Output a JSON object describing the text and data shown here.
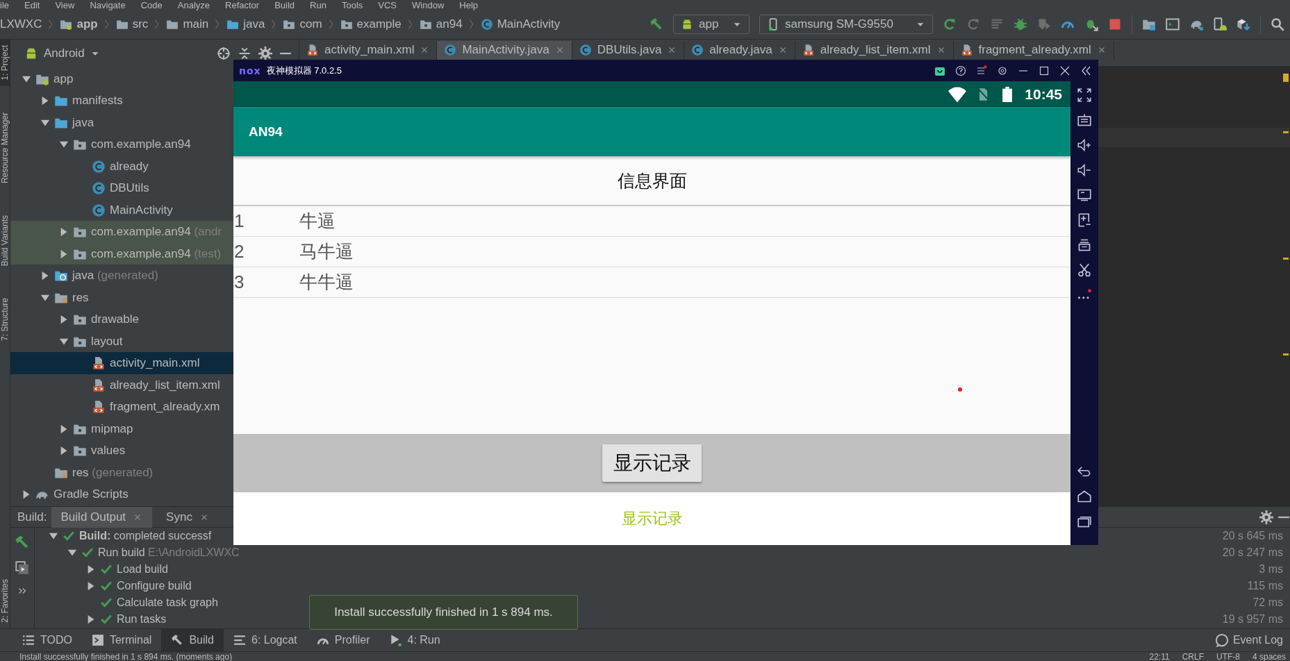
{
  "menu_bar": [
    "ile",
    "Edit",
    "View",
    "Navigate",
    "Code",
    "Analyze",
    "Refactor",
    "Build",
    "Run",
    "Tools",
    "VCS",
    "Window",
    "Help"
  ],
  "breadcrumbs": [
    {
      "label": "LXWXC",
      "kind": "project"
    },
    {
      "label": "app",
      "kind": "module"
    },
    {
      "label": "src",
      "kind": "folder"
    },
    {
      "label": "main",
      "kind": "folder"
    },
    {
      "label": "java",
      "kind": "source"
    },
    {
      "label": "com",
      "kind": "package"
    },
    {
      "label": "example",
      "kind": "package"
    },
    {
      "label": "an94",
      "kind": "package"
    },
    {
      "label": "MainActivity",
      "kind": "class"
    }
  ],
  "run_config": {
    "label": "app"
  },
  "device": {
    "label": "samsung SM-G9550"
  },
  "left_stripe": {
    "top": [
      {
        "label": "1: Project",
        "selected": true
      },
      {
        "label": "Resource Manager",
        "selected": false
      },
      {
        "label": "Build Variants",
        "selected": false
      },
      {
        "label": "7: Structure",
        "selected": false
      }
    ],
    "bottom": [
      {
        "label": "2: Favorites",
        "selected": false
      }
    ]
  },
  "project_panel": {
    "view": "Android",
    "tree": [
      {
        "label": "app",
        "kind": "module",
        "expanded": true,
        "selected": false,
        "children": [
          {
            "label": "manifests",
            "kind": "folder",
            "expanded": false,
            "selected": false
          },
          {
            "label": "java",
            "kind": "folder",
            "expanded": true,
            "selected": false,
            "children": [
              {
                "label": "com.example.an94",
                "kind": "package",
                "expanded": true,
                "selected": false,
                "children": [
                  {
                    "label": "already",
                    "kind": "class",
                    "selected": false
                  },
                  {
                    "label": "DBUtils",
                    "kind": "class",
                    "selected": false
                  },
                  {
                    "label": "MainActivity",
                    "kind": "class",
                    "selected": false
                  }
                ]
              },
              {
                "label": "com.example.an94",
                "suffix": "(andr",
                "kind": "package",
                "expanded": false,
                "selected": false,
                "highlighted": true
              },
              {
                "label": "com.example.an94",
                "suffix": "(test)",
                "kind": "package",
                "expanded": false,
                "selected": false,
                "highlighted": true
              }
            ]
          },
          {
            "label": "java",
            "suffix": "(generated)",
            "kind": "generated",
            "expanded": false,
            "selected": false
          },
          {
            "label": "res",
            "kind": "res",
            "expanded": true,
            "selected": false,
            "children": [
              {
                "label": "drawable",
                "kind": "package",
                "expanded": false,
                "selected": false
              },
              {
                "label": "layout",
                "kind": "package",
                "expanded": true,
                "selected": false,
                "children": [
                  {
                    "label": "activity_main.xml",
                    "kind": "xml",
                    "selected": true
                  },
                  {
                    "label": "already_list_item.xml",
                    "kind": "xml",
                    "selected": false
                  },
                  {
                    "label": "fragment_already.xm",
                    "kind": "xml",
                    "selected": false
                  }
                ]
              },
              {
                "label": "mipmap",
                "kind": "package",
                "expanded": false,
                "selected": false
              },
              {
                "label": "values",
                "kind": "package",
                "expanded": false,
                "selected": false
              }
            ]
          },
          {
            "label": "res",
            "suffix": "(generated)",
            "kind": "res",
            "selected": false
          }
        ]
      },
      {
        "label": "Gradle Scripts",
        "kind": "gradle",
        "expanded": false,
        "selected": false
      }
    ]
  },
  "editor_tabs": [
    {
      "label": "activity_main.xml",
      "kind": "xml",
      "selected": false
    },
    {
      "label": "MainActivity.java",
      "kind": "class",
      "selected": true
    },
    {
      "label": "DBUtils.java",
      "kind": "class",
      "selected": false
    },
    {
      "label": "already.java",
      "kind": "class",
      "selected": false
    },
    {
      "label": "already_list_item.xml",
      "kind": "xml",
      "selected": false
    },
    {
      "label": "fragment_already.xml",
      "kind": "xml",
      "selected": false
    }
  ],
  "emulator": {
    "logo": "nox",
    "title": "夜神模拟器 7.0.2.5",
    "time": "10:45",
    "app_title": "AN94",
    "header": "信息界面",
    "rows": [
      {
        "number": "1",
        "name": "牛逼"
      },
      {
        "number": "2",
        "name": "马牛逼"
      },
      {
        "number": "3",
        "name": "牛牛逼"
      }
    ],
    "button": "显示记录",
    "result_text": "显示记录"
  },
  "build_panel": {
    "label": "Build:",
    "tabs": [
      {
        "label": "Build Output",
        "selected": true
      },
      {
        "label": "Sync",
        "selected": false
      }
    ],
    "rows": [
      {
        "text": "**Build:** completed successf",
        "time": "20 s 645 ms",
        "expanded": true,
        "children": [
          {
            "text": "Run build",
            "detail": "E:\\AndroidLXWXC",
            "time": "20 s 247 ms",
            "expanded": true,
            "children": [
              {
                "text": "Load build",
                "time": "3 ms",
                "expanded": false
              },
              {
                "text": "Configure build",
                "time": "115 ms",
                "expanded": false
              },
              {
                "text": "Calculate task graph",
                "time": "72 ms"
              },
              {
                "text": "Run tasks",
                "time": "19 s 957 ms",
                "expanded": false
              }
            ]
          }
        ]
      }
    ]
  },
  "notification": {
    "text": "Install successfully finished in 1 s 894 ms."
  },
  "tool_windows": [
    {
      "label": "TODO",
      "kind": "todo",
      "selected": false
    },
    {
      "label": "Terminal",
      "kind": "terminal",
      "selected": false
    },
    {
      "label": "Build",
      "kind": "build",
      "selected": true
    },
    {
      "label": "6: Logcat",
      "kind": "logcat",
      "selected": false
    },
    {
      "label": "Profiler",
      "kind": "profiler",
      "selected": false
    },
    {
      "label": "4: Run",
      "kind": "run",
      "selected": false
    }
  ],
  "event_log": {
    "label": "Event Log"
  },
  "status_bar": {
    "message": "Install successfully finished in 1 s 894 ms. (moments ago)",
    "position": "22:11",
    "line_separator": "CRLF",
    "encoding": "UTF-8",
    "indent": "4 spaces"
  }
}
